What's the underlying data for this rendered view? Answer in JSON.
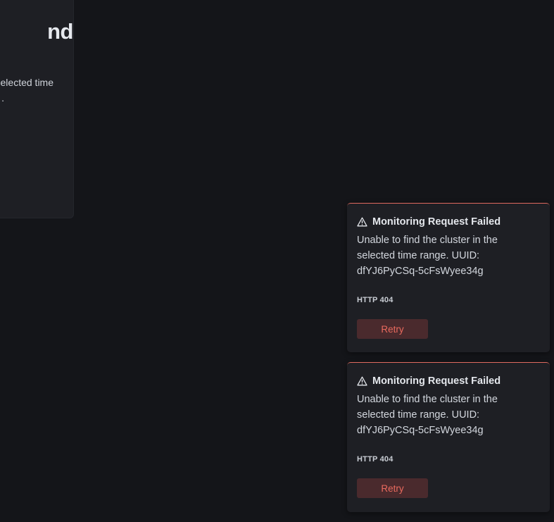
{
  "background_panel": {
    "title_fragment": "nd",
    "text_line1": "elected time",
    "text_line2": "."
  },
  "toasts": [
    {
      "icon": "warning-icon",
      "title": "Monitoring Request Failed",
      "message": "Unable to find the cluster in the selected time range. UUID: dfYJ6PyCSq-5cFsWyee34g",
      "code": "HTTP 404",
      "action_label": "Retry",
      "accent_color": "#e06a5f"
    },
    {
      "icon": "warning-icon",
      "title": "Monitoring Request Failed",
      "message": "Unable to find the cluster in the selected time range. UUID: dfYJ6PyCSq-5cFsWyee34g",
      "code": "HTTP 404",
      "action_label": "Retry",
      "accent_color": "#e06a5f"
    }
  ]
}
